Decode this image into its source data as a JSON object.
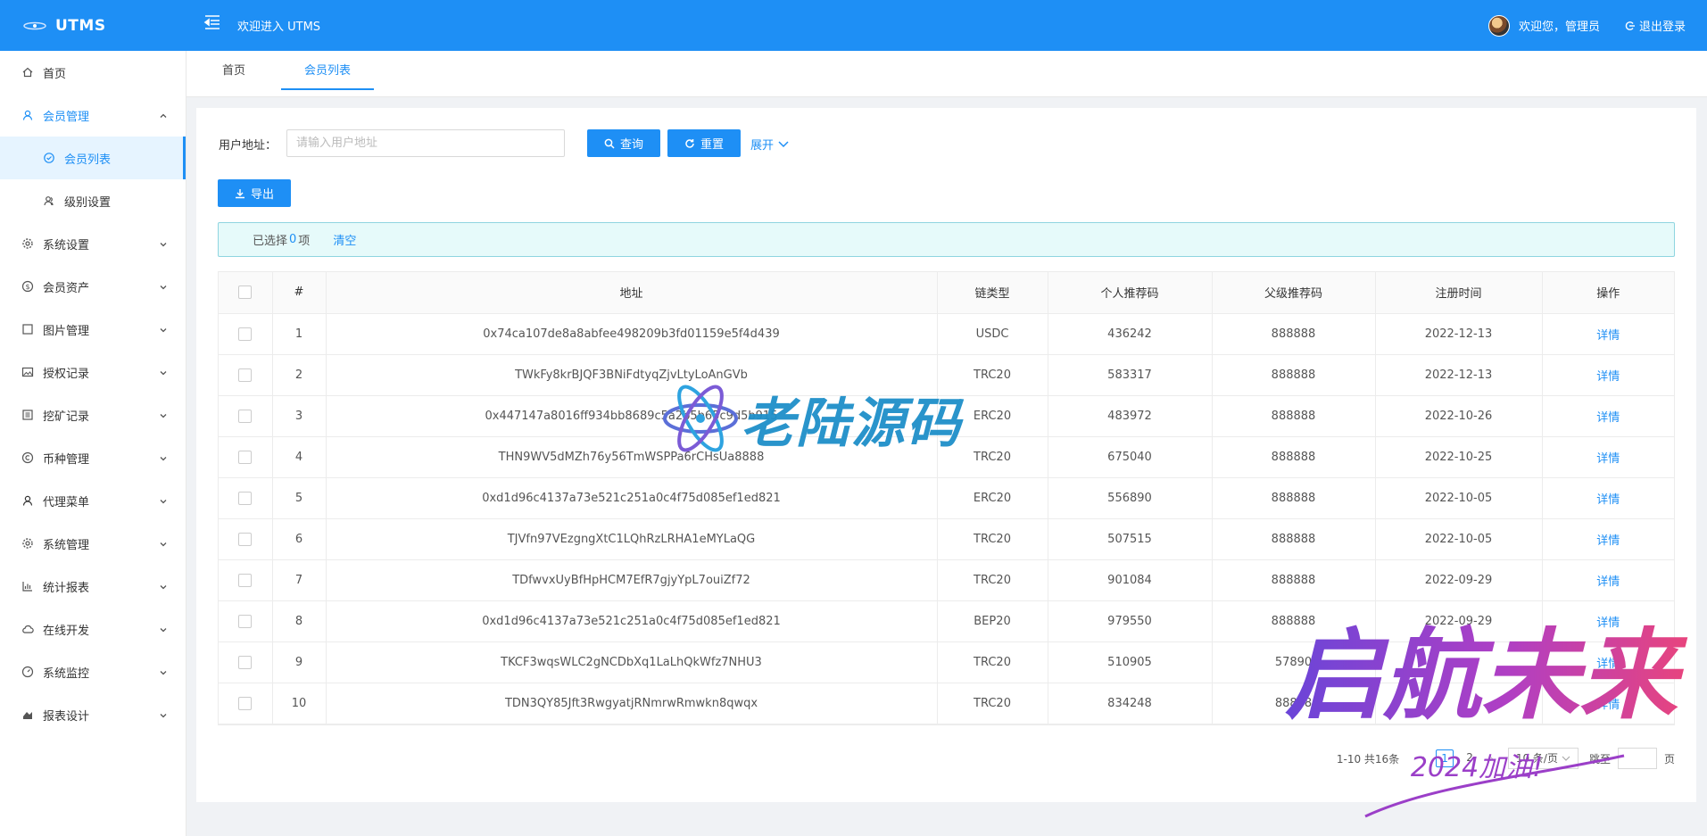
{
  "header": {
    "logo_text": "UTMS",
    "welcome_title": "欢迎进入 UTMS",
    "greeting": "欢迎您，管理员",
    "logout_label": "退出登录"
  },
  "sidebar": {
    "items": [
      {
        "label": "首页",
        "icon": "home-icon"
      },
      {
        "label": "会员管理",
        "icon": "user-icon",
        "open": true
      },
      {
        "label": "会员列表",
        "icon": "check-circle-icon",
        "sub": true,
        "active": true
      },
      {
        "label": "级别设置",
        "icon": "users-icon",
        "sub": true
      },
      {
        "label": "系统设置",
        "icon": "gear-icon"
      },
      {
        "label": "会员资产",
        "icon": "dollar-icon"
      },
      {
        "label": "图片管理",
        "icon": "square-icon"
      },
      {
        "label": "授权记录",
        "icon": "image-icon"
      },
      {
        "label": "挖矿记录",
        "icon": "list-icon"
      },
      {
        "label": "币种管理",
        "icon": "copyright-icon"
      },
      {
        "label": "代理菜单",
        "icon": "user-icon"
      },
      {
        "label": "系统管理",
        "icon": "gear-icon"
      },
      {
        "label": "统计报表",
        "icon": "bar-chart-icon"
      },
      {
        "label": "在线开发",
        "icon": "cloud-icon"
      },
      {
        "label": "系统监控",
        "icon": "dashboard-icon"
      },
      {
        "label": "报表设计",
        "icon": "area-chart-icon"
      }
    ]
  },
  "tabs": [
    {
      "label": "首页"
    },
    {
      "label": "会员列表",
      "active": true
    }
  ],
  "search": {
    "label": "用户地址：",
    "placeholder": "请输入用户地址",
    "query_label": "查询",
    "reset_label": "重置",
    "expand_label": "展开"
  },
  "toolbar": {
    "export_label": "导出"
  },
  "selection": {
    "prefix": "已选择",
    "count": "0",
    "suffix": "项",
    "clear_label": "清空"
  },
  "table": {
    "headers": [
      "#",
      "地址",
      "链类型",
      "个人推荐码",
      "父级推荐码",
      "注册时间",
      "操作"
    ],
    "action_label": "详情",
    "rows": [
      {
        "no": "1",
        "address": "0x74ca107de8a8abfee498209b3fd01159e5f4d439",
        "chain": "USDC",
        "code": "436242",
        "parent": "888888",
        "date": "2022-12-13"
      },
      {
        "no": "2",
        "address": "TWkFy8krBJQF3BNiFdtyqZjvLtyLoAnGVb",
        "chain": "TRC20",
        "code": "583317",
        "parent": "888888",
        "date": "2022-12-13"
      },
      {
        "no": "3",
        "address": "0x447147a8016ff934bb8689c5a2b5b65c9d5b915",
        "chain": "ERC20",
        "code": "483972",
        "parent": "888888",
        "date": "2022-10-26"
      },
      {
        "no": "4",
        "address": "THN9WV5dMZh76y56TmWSPPa6rCHsUa8888",
        "chain": "TRC20",
        "code": "675040",
        "parent": "888888",
        "date": "2022-10-25"
      },
      {
        "no": "5",
        "address": "0xd1d96c4137a73e521c251a0c4f75d085ef1ed821",
        "chain": "ERC20",
        "code": "556890",
        "parent": "888888",
        "date": "2022-10-05"
      },
      {
        "no": "6",
        "address": "TJVfn97VEzgngXtC1LQhRzLRHA1eMYLaQG",
        "chain": "TRC20",
        "code": "507515",
        "parent": "888888",
        "date": "2022-10-05"
      },
      {
        "no": "7",
        "address": "TDfwvxUyBfHpHCM7EfR7gjyYpL7ouiZf72",
        "chain": "TRC20",
        "code": "901084",
        "parent": "888888",
        "date": "2022-09-29"
      },
      {
        "no": "8",
        "address": "0xd1d96c4137a73e521c251a0c4f75d085ef1ed821",
        "chain": "BEP20",
        "code": "979550",
        "parent": "888888",
        "date": "2022-09-29"
      },
      {
        "no": "9",
        "address": "TKCF3wqsWLC2gNCDbXq1LaLhQkWfz7NHU3",
        "chain": "TRC20",
        "code": "510905",
        "parent": "57890",
        "date": ""
      },
      {
        "no": "10",
        "address": "TDN3QY85Jft3RwgyatjRNmrwRmwkn8qwqx",
        "chain": "TRC20",
        "code": "834248",
        "parent": "88888",
        "date": ""
      }
    ]
  },
  "pagination": {
    "total_text": "1-10 共16条",
    "pages": [
      "1",
      "2"
    ],
    "current": "1",
    "page_size": "10 条/页",
    "goto_label": "跳至",
    "page_unit": "页"
  },
  "watermarks": {
    "center_text": "老陆源码",
    "corner_text": "启航未来",
    "corner_sub": "2024加油!"
  },
  "colors": {
    "primary": "#1e8ff5",
    "alert_bg": "#e6fafa",
    "alert_border": "#8fd5e0"
  }
}
